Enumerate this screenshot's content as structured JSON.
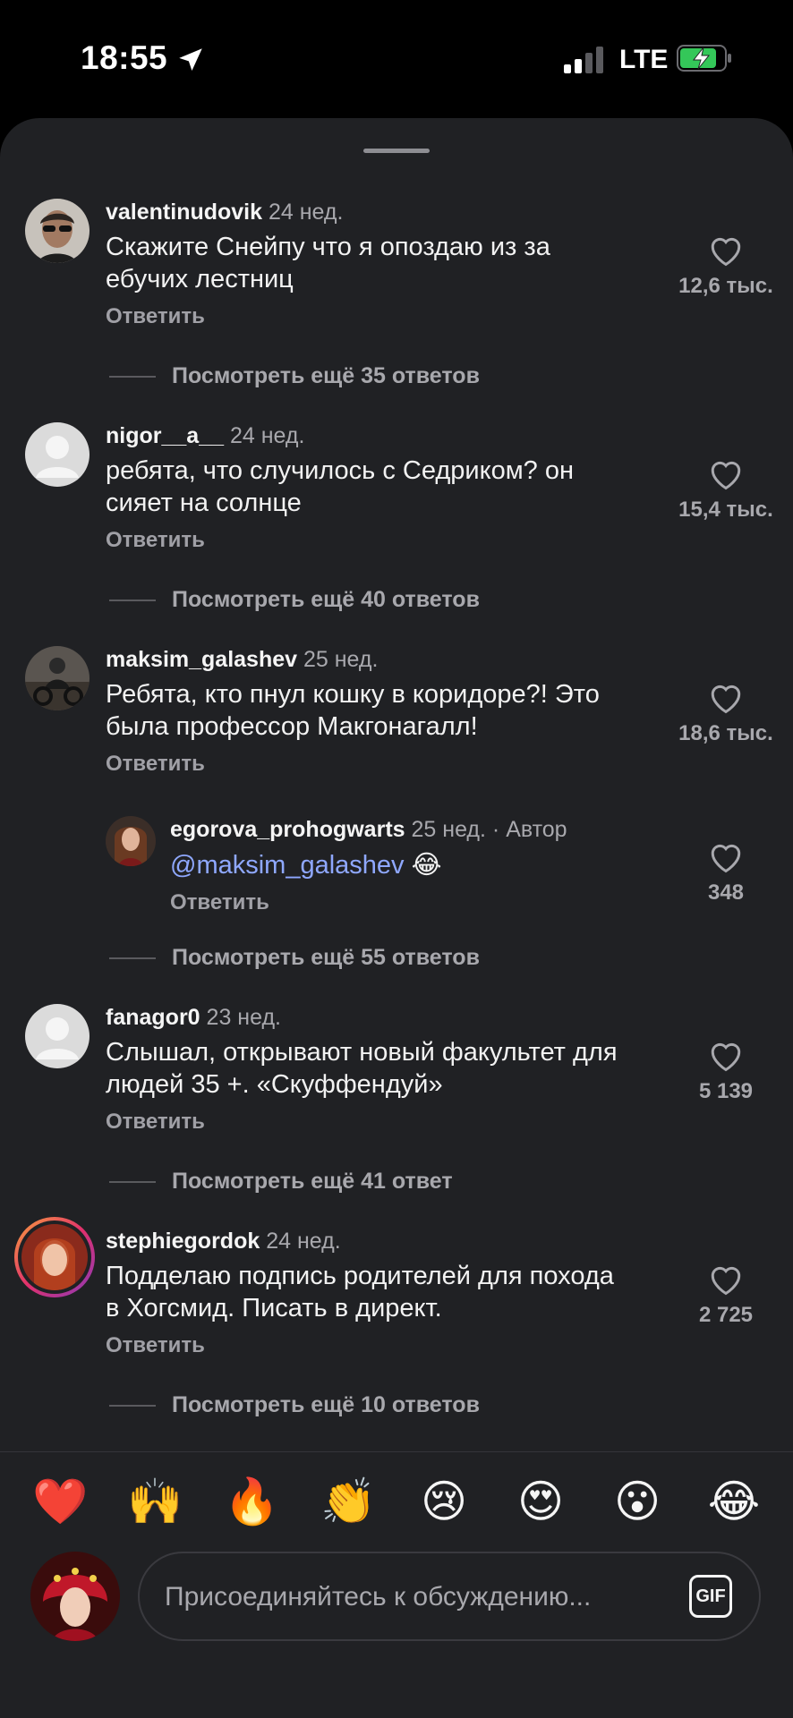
{
  "status_bar": {
    "time": "18:55",
    "network": "LTE"
  },
  "comments": [
    {
      "username": "valentinudovik",
      "ago": "24 нед.",
      "text_line1": "Скажите Снейпу что я опоздаю из за",
      "text_line2": "ебучих лестниц",
      "reply_label": "Ответить",
      "likes": "12,6 тыс.",
      "view_more": "Посмотреть ещё 35 ответов"
    },
    {
      "username": "nigor__a__",
      "ago": "24 нед.",
      "text_line1": "ребята, что случилось с Седриком? он",
      "text_line2": "сияет на солнце",
      "reply_label": "Ответить",
      "likes": "15,4 тыс.",
      "view_more": "Посмотреть ещё 40 ответов"
    },
    {
      "username": "maksim_galashev",
      "ago": "25 нед.",
      "text_line1": "Ребята, кто пнул кошку в коридоре?! Это",
      "text_line2": "была профессор Макгонагалл!",
      "reply_label": "Ответить",
      "likes": "18,6 тыс.",
      "reply": {
        "username": "egorova_prohogwarts",
        "ago": "25 нед.",
        "separator": "·",
        "author_badge": "Автор",
        "mention": "@maksim_galashev",
        "emoji": "😂",
        "reply_label": "Ответить",
        "likes": "348"
      },
      "view_more": "Посмотреть ещё 55 ответов"
    },
    {
      "username": "fanagor0",
      "ago": "23 нед.",
      "text_line1": "Слышал, открывают новый факультет для",
      "text_line2": "людей 35 +. «Скуффендуй»",
      "reply_label": "Ответить",
      "likes": "5 139",
      "view_more": "Посмотреть ещё 41 ответ"
    },
    {
      "username": "stephiegordok",
      "ago": "24 нед.",
      "text_line1": "Подделаю подпись родителей для похода",
      "text_line2": "в Хогсмид. Писать в директ.",
      "reply_label": "Ответить",
      "likes": "2 725",
      "view_more": "Посмотреть ещё 10 ответов"
    }
  ],
  "reactions": [
    "❤️",
    "🙌",
    "🔥",
    "👏",
    "😢",
    "😍",
    "😮",
    "😂"
  ],
  "composer": {
    "placeholder": "Присоединяйтесь к обсуждению...",
    "gif_label": "GIF"
  },
  "colors": {
    "sheet": "#202124",
    "mention": "#8fa8ff",
    "secondary_text": "#a8a8ad",
    "battery_green": "#34c759"
  },
  "icons": [
    "location-arrow-icon",
    "signal-icon",
    "battery-charging-icon",
    "heart-outline-icon",
    "avatar-placeholder-icon"
  ]
}
